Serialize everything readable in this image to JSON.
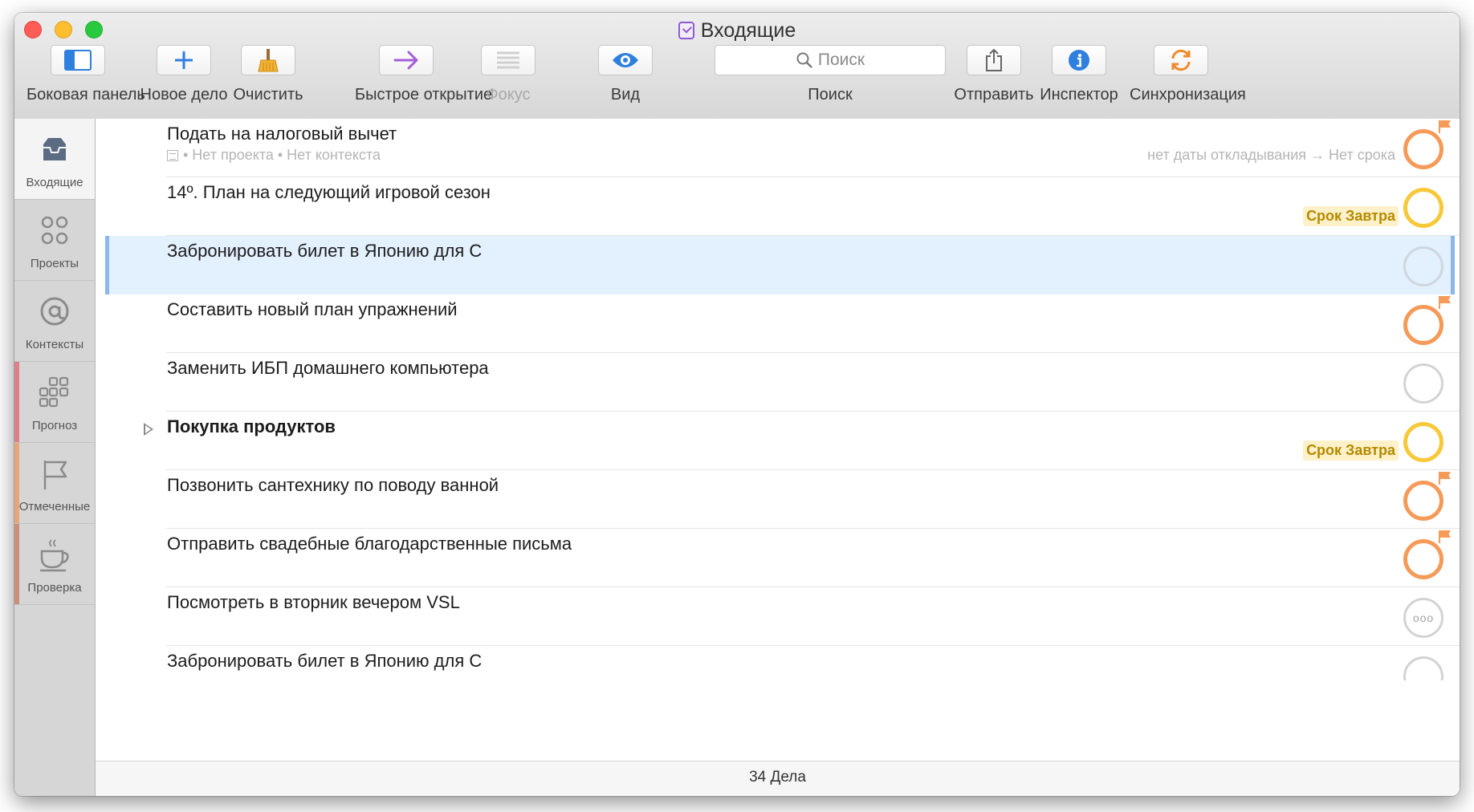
{
  "window": {
    "title": "Входящие"
  },
  "toolbar": {
    "sidebar_label": "Боковая панель",
    "new_action_label": "Новое дело",
    "clean_up_label": "Очистить",
    "quick_open_label": "Быстрое открытие",
    "focus_label": "Фокус",
    "view_label": "Вид",
    "search_placeholder": "Поиск",
    "search_label": "Поиск",
    "share_label": "Отправить",
    "inspector_label": "Инспектор",
    "sync_label": "Синхронизация"
  },
  "sidebar": {
    "tabs": [
      {
        "label": "Входящие",
        "icon": "inbox-icon"
      },
      {
        "label": "Проекты",
        "icon": "projects-icon"
      },
      {
        "label": "Контексты",
        "icon": "at-icon"
      },
      {
        "label": "Прогноз",
        "icon": "forecast-grid-icon"
      },
      {
        "label": "Отмеченные",
        "icon": "flag-icon"
      },
      {
        "label": "Проверка",
        "icon": "coffee-cup-icon"
      }
    ],
    "colors": {
      "forecast": "#e07f8a",
      "flagged": "#e8a57c",
      "review": "#c98f7a"
    }
  },
  "tasks": [
    {
      "title": "Подать на налоговый вычет",
      "meta": "• Нет проекта • Нет контекста",
      "dates": "нет даты откладывания → Нет срока",
      "status": "overdue",
      "flagged": true
    },
    {
      "title": "14º. План на следующий игровой сезон",
      "due": "Срок Завтра",
      "status": "due-soon"
    },
    {
      "title": "Забронировать билет в Японию для С",
      "status": "plain",
      "selected": true
    },
    {
      "title": "Составить новый план упражнений",
      "status": "overdue",
      "flagged": true
    },
    {
      "title": "Заменить ИБП домашнего компьютера",
      "status": "plain"
    },
    {
      "title": "Покупка продуктов",
      "due": "Срок Завтра",
      "status": "due-soon",
      "group": true
    },
    {
      "title": "Позвонить сантехнику по поводу ванной",
      "status": "overdue",
      "flagged": true
    },
    {
      "title": "Отправить свадебные благодарственные письма",
      "status": "overdue",
      "flagged": true
    },
    {
      "title": "Посмотреть в вторник вечером VSL",
      "status": "repeat",
      "status_glyph": "ooo"
    },
    {
      "title": "Забронировать билет в Японию для С",
      "status": "plain"
    }
  ],
  "footer": {
    "count_label": "34 Дела"
  },
  "colors": {
    "overdue": "#f59a58",
    "due_soon": "#f7c93a",
    "accent": "#4a90e2",
    "selection": "#e3f0fd"
  }
}
